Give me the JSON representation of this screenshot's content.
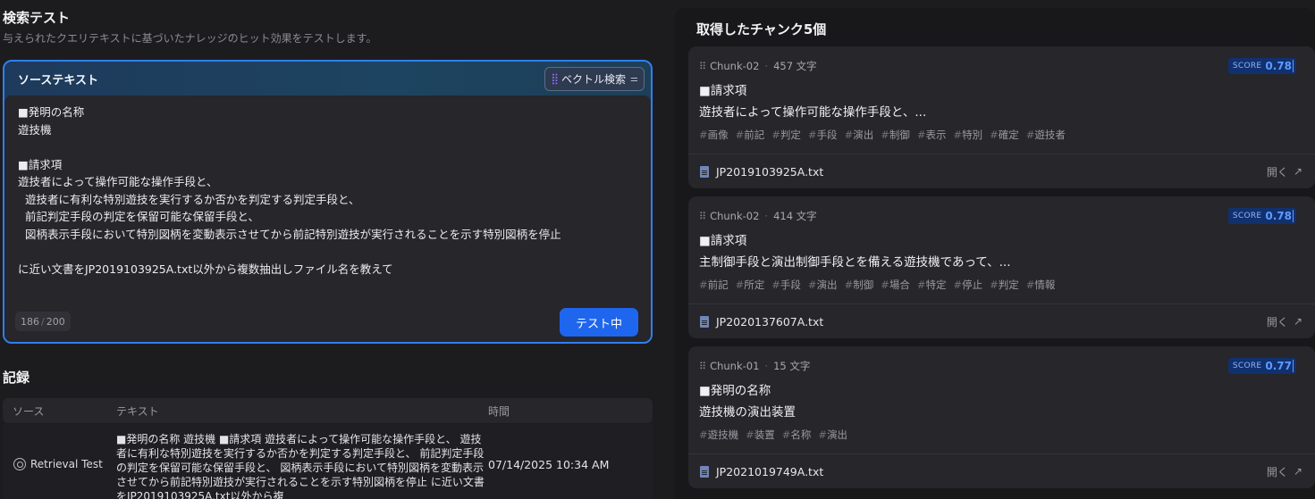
{
  "page": {
    "title": "検索テスト",
    "description": "与えられたクエリテキストに基づいたナレッジのヒット効果をテストします。"
  },
  "source": {
    "title": "ソーステキスト",
    "method_label": "ベクトル検索",
    "query": "■発明の名称\n遊技機\n\n■請求項\n遊技者によって操作可能な操作手段と、\n  遊技者に有利な特別遊技を実行するか否かを判定する判定手段と、\n  前記判定手段の判定を保留可能な保留手段と、\n  図柄表示手段において特別図柄を変動表示させてから前記特別遊技が実行されることを示す特別図柄を停止\n\nに近い文書をJP2019103925A.txt以外から複数抽出しファイル名を教えて",
    "char_count": "186",
    "char_max": "200",
    "submit_label": "テスト中"
  },
  "records": {
    "title": "記録",
    "columns": [
      "ソース",
      "テキスト",
      "時間"
    ],
    "rows": [
      {
        "source": "Retrieval Test",
        "text": "■発明の名称 遊技機 ■請求項 遊技者によって操作可能な操作手段と、 遊技者に有利な特別遊技を実行するか否かを判定する判定手段と、 前記判定手段の判定を保留可能な保留手段と、 図柄表示手段において特別図柄を変動表示させてから前記特別遊技が実行されることを示す特別図柄を停止 に近い文書をJP2019103925A.txt以外から複",
        "time": "07/14/2025 10:34 AM"
      }
    ]
  },
  "results": {
    "title": "取得したチャンク5個",
    "score_label": "SCORE",
    "open_label": "開く",
    "chunks": [
      {
        "id": "Chunk-02",
        "size": "457 文字",
        "score": "0.78",
        "heading": "■請求項",
        "body": "遊技者によって操作可能な操作手段と、...",
        "tags": [
          "画像",
          "前記",
          "判定",
          "手段",
          "演出",
          "制御",
          "表示",
          "特別",
          "確定",
          "遊技者"
        ],
        "file": "JP2019103925A.txt"
      },
      {
        "id": "Chunk-02",
        "size": "414 文字",
        "score": "0.78",
        "heading": "■請求項",
        "body": "主制御手段と演出制御手段とを備える遊技機であって、...",
        "tags": [
          "前記",
          "所定",
          "手段",
          "演出",
          "制御",
          "場合",
          "特定",
          "停止",
          "判定",
          "情報"
        ],
        "file": "JP2020137607A.txt"
      },
      {
        "id": "Chunk-01",
        "size": "15 文字",
        "score": "0.77",
        "heading": "■発明の名称",
        "body": "遊技機の演出装置",
        "tags": [
          "遊技機",
          "装置",
          "名称",
          "演出"
        ],
        "file": "JP2021019749A.txt"
      }
    ]
  },
  "icons": {
    "vector_search": "vector-grid-icon",
    "settings": "tune-icon",
    "record_source": "target-icon",
    "chunk": "drag-grid-icon",
    "file": "document-icon",
    "open": "arrow-up-right-icon"
  },
  "colors": {
    "accent": "#1f66ee",
    "card_border": "#2f7ff0",
    "score_text": "#5d9bff"
  }
}
